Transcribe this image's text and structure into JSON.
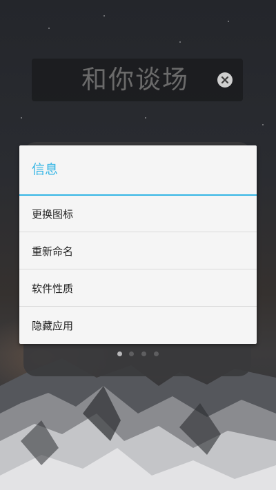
{
  "folder": {
    "title": "和你谈场",
    "clear_icon": "close-circle-icon"
  },
  "dialog": {
    "title": "信息",
    "items": [
      {
        "label": "更换图标"
      },
      {
        "label": "重新命名"
      },
      {
        "label": "软件性质"
      },
      {
        "label": "隐藏应用"
      }
    ]
  },
  "pager": {
    "count": 4,
    "active_index": 0
  },
  "colors": {
    "accent": "#33b5e5",
    "dialog_bg": "#f5f5f5",
    "text": "#222222"
  }
}
